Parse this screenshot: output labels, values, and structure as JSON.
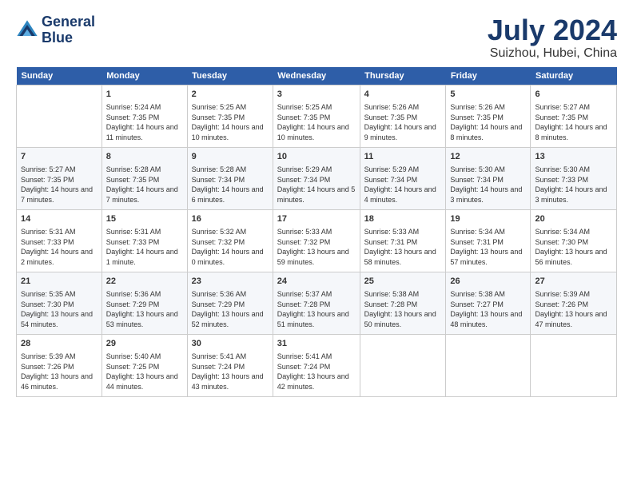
{
  "logo": {
    "line1": "General",
    "line2": "Blue"
  },
  "title": "July 2024",
  "subtitle": "Suizhou, Hubei, China",
  "headers": [
    "Sunday",
    "Monday",
    "Tuesday",
    "Wednesday",
    "Thursday",
    "Friday",
    "Saturday"
  ],
  "weeks": [
    [
      {
        "date": "",
        "sunrise": "",
        "sunset": "",
        "daylight": ""
      },
      {
        "date": "1",
        "sunrise": "Sunrise: 5:24 AM",
        "sunset": "Sunset: 7:35 PM",
        "daylight": "Daylight: 14 hours and 11 minutes."
      },
      {
        "date": "2",
        "sunrise": "Sunrise: 5:25 AM",
        "sunset": "Sunset: 7:35 PM",
        "daylight": "Daylight: 14 hours and 10 minutes."
      },
      {
        "date": "3",
        "sunrise": "Sunrise: 5:25 AM",
        "sunset": "Sunset: 7:35 PM",
        "daylight": "Daylight: 14 hours and 10 minutes."
      },
      {
        "date": "4",
        "sunrise": "Sunrise: 5:26 AM",
        "sunset": "Sunset: 7:35 PM",
        "daylight": "Daylight: 14 hours and 9 minutes."
      },
      {
        "date": "5",
        "sunrise": "Sunrise: 5:26 AM",
        "sunset": "Sunset: 7:35 PM",
        "daylight": "Daylight: 14 hours and 8 minutes."
      },
      {
        "date": "6",
        "sunrise": "Sunrise: 5:27 AM",
        "sunset": "Sunset: 7:35 PM",
        "daylight": "Daylight: 14 hours and 8 minutes."
      }
    ],
    [
      {
        "date": "7",
        "sunrise": "Sunrise: 5:27 AM",
        "sunset": "Sunset: 7:35 PM",
        "daylight": "Daylight: 14 hours and 7 minutes."
      },
      {
        "date": "8",
        "sunrise": "Sunrise: 5:28 AM",
        "sunset": "Sunset: 7:35 PM",
        "daylight": "Daylight: 14 hours and 7 minutes."
      },
      {
        "date": "9",
        "sunrise": "Sunrise: 5:28 AM",
        "sunset": "Sunset: 7:34 PM",
        "daylight": "Daylight: 14 hours and 6 minutes."
      },
      {
        "date": "10",
        "sunrise": "Sunrise: 5:29 AM",
        "sunset": "Sunset: 7:34 PM",
        "daylight": "Daylight: 14 hours and 5 minutes."
      },
      {
        "date": "11",
        "sunrise": "Sunrise: 5:29 AM",
        "sunset": "Sunset: 7:34 PM",
        "daylight": "Daylight: 14 hours and 4 minutes."
      },
      {
        "date": "12",
        "sunrise": "Sunrise: 5:30 AM",
        "sunset": "Sunset: 7:34 PM",
        "daylight": "Daylight: 14 hours and 3 minutes."
      },
      {
        "date": "13",
        "sunrise": "Sunrise: 5:30 AM",
        "sunset": "Sunset: 7:33 PM",
        "daylight": "Daylight: 14 hours and 3 minutes."
      }
    ],
    [
      {
        "date": "14",
        "sunrise": "Sunrise: 5:31 AM",
        "sunset": "Sunset: 7:33 PM",
        "daylight": "Daylight: 14 hours and 2 minutes."
      },
      {
        "date": "15",
        "sunrise": "Sunrise: 5:31 AM",
        "sunset": "Sunset: 7:33 PM",
        "daylight": "Daylight: 14 hours and 1 minute."
      },
      {
        "date": "16",
        "sunrise": "Sunrise: 5:32 AM",
        "sunset": "Sunset: 7:32 PM",
        "daylight": "Daylight: 14 hours and 0 minutes."
      },
      {
        "date": "17",
        "sunrise": "Sunrise: 5:33 AM",
        "sunset": "Sunset: 7:32 PM",
        "daylight": "Daylight: 13 hours and 59 minutes."
      },
      {
        "date": "18",
        "sunrise": "Sunrise: 5:33 AM",
        "sunset": "Sunset: 7:31 PM",
        "daylight": "Daylight: 13 hours and 58 minutes."
      },
      {
        "date": "19",
        "sunrise": "Sunrise: 5:34 AM",
        "sunset": "Sunset: 7:31 PM",
        "daylight": "Daylight: 13 hours and 57 minutes."
      },
      {
        "date": "20",
        "sunrise": "Sunrise: 5:34 AM",
        "sunset": "Sunset: 7:30 PM",
        "daylight": "Daylight: 13 hours and 56 minutes."
      }
    ],
    [
      {
        "date": "21",
        "sunrise": "Sunrise: 5:35 AM",
        "sunset": "Sunset: 7:30 PM",
        "daylight": "Daylight: 13 hours and 54 minutes."
      },
      {
        "date": "22",
        "sunrise": "Sunrise: 5:36 AM",
        "sunset": "Sunset: 7:29 PM",
        "daylight": "Daylight: 13 hours and 53 minutes."
      },
      {
        "date": "23",
        "sunrise": "Sunrise: 5:36 AM",
        "sunset": "Sunset: 7:29 PM",
        "daylight": "Daylight: 13 hours and 52 minutes."
      },
      {
        "date": "24",
        "sunrise": "Sunrise: 5:37 AM",
        "sunset": "Sunset: 7:28 PM",
        "daylight": "Daylight: 13 hours and 51 minutes."
      },
      {
        "date": "25",
        "sunrise": "Sunrise: 5:38 AM",
        "sunset": "Sunset: 7:28 PM",
        "daylight": "Daylight: 13 hours and 50 minutes."
      },
      {
        "date": "26",
        "sunrise": "Sunrise: 5:38 AM",
        "sunset": "Sunset: 7:27 PM",
        "daylight": "Daylight: 13 hours and 48 minutes."
      },
      {
        "date": "27",
        "sunrise": "Sunrise: 5:39 AM",
        "sunset": "Sunset: 7:26 PM",
        "daylight": "Daylight: 13 hours and 47 minutes."
      }
    ],
    [
      {
        "date": "28",
        "sunrise": "Sunrise: 5:39 AM",
        "sunset": "Sunset: 7:26 PM",
        "daylight": "Daylight: 13 hours and 46 minutes."
      },
      {
        "date": "29",
        "sunrise": "Sunrise: 5:40 AM",
        "sunset": "Sunset: 7:25 PM",
        "daylight": "Daylight: 13 hours and 44 minutes."
      },
      {
        "date": "30",
        "sunrise": "Sunrise: 5:41 AM",
        "sunset": "Sunset: 7:24 PM",
        "daylight": "Daylight: 13 hours and 43 minutes."
      },
      {
        "date": "31",
        "sunrise": "Sunrise: 5:41 AM",
        "sunset": "Sunset: 7:24 PM",
        "daylight": "Daylight: 13 hours and 42 minutes."
      },
      {
        "date": "",
        "sunrise": "",
        "sunset": "",
        "daylight": ""
      },
      {
        "date": "",
        "sunrise": "",
        "sunset": "",
        "daylight": ""
      },
      {
        "date": "",
        "sunrise": "",
        "sunset": "",
        "daylight": ""
      }
    ]
  ]
}
